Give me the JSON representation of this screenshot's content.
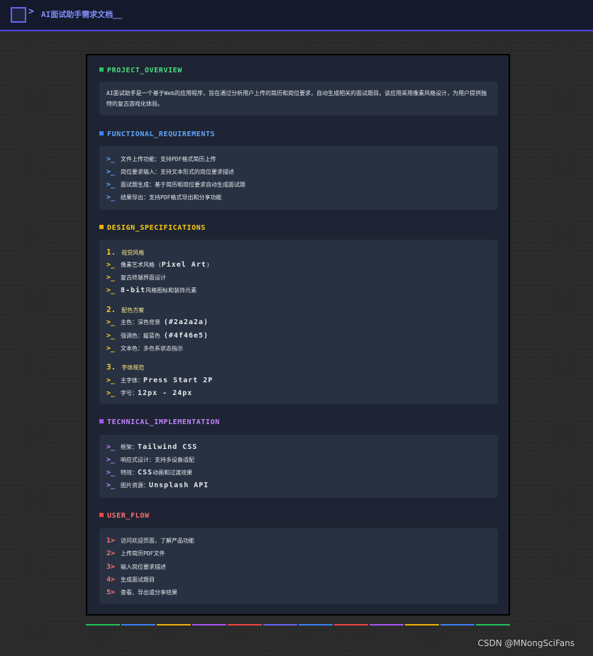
{
  "header": {
    "logo": "pixel-square-icon",
    "chevron": ">",
    "title": "AI面试助手需求文档__"
  },
  "colors": {
    "accent": "#4f46e5",
    "green": "#22c55e",
    "blue": "#60a5fa",
    "yellow": "#facc15",
    "purple": "#c084fc",
    "red": "#f87171"
  },
  "sections": {
    "overview": {
      "title": "PROJECT_OVERVIEW",
      "text": "AI面试助手是一个基于Web的应用程序，旨在通过分析用户上传的简历和岗位要求，自动生成相关的面试题目。该应用采用像素风格设计，为用户提供独特的复古游戏化体验。"
    },
    "functional": {
      "title": "FUNCTIONAL_REQUIREMENTS",
      "marker": ">_",
      "items": [
        "文件上传功能：支持PDF格式简历上传",
        "岗位要求输入：支持文本形式的岗位要求描述",
        "面试题生成：基于简历和岗位要求自动生成面试题",
        "结果导出：支持PDF格式导出和分享功能"
      ]
    },
    "design": {
      "title": "DESIGN_SPECIFICATIONS",
      "marker": ">_",
      "groups": [
        {
          "num": "1.",
          "heading": "视觉风格",
          "items": [
            {
              "zh": "像素艺术风格 (",
              "en": "Pixel Art",
              "tail": ")"
            },
            {
              "zh": "复古终端界面设计",
              "en": "",
              "tail": ""
            },
            {
              "zh": "",
              "en": "8-bit",
              "tail": "风格图标和装饰元素"
            }
          ]
        },
        {
          "num": "2.",
          "heading": "配色方案",
          "items": [
            {
              "zh": "主色：深色背景 ",
              "en": "(#2a2a2a)",
              "tail": ""
            },
            {
              "zh": "强调色：靛蓝色 ",
              "en": "(#4f46e5)",
              "tail": ""
            },
            {
              "zh": "文本色：多色系状态指示",
              "en": "",
              "tail": ""
            }
          ]
        },
        {
          "num": "3.",
          "heading": "字体规范",
          "items": [
            {
              "zh": "主字体：",
              "en": "Press Start 2P",
              "tail": ""
            },
            {
              "zh": "字号：",
              "en": "12px - 24px",
              "tail": ""
            }
          ]
        }
      ]
    },
    "technical": {
      "title": "TECHNICAL_IMPLEMENTATION",
      "marker": ">_",
      "items": [
        {
          "zh": "框架：",
          "en": "Tailwind CSS",
          "tail": ""
        },
        {
          "zh": "响应式设计：支持多设备适配",
          "en": "",
          "tail": ""
        },
        {
          "zh": "特效：",
          "en": "CSS",
          "tail": "动画和过渡效果"
        },
        {
          "zh": "图片资源：",
          "en": "Unsplash API",
          "tail": ""
        }
      ]
    },
    "userflow": {
      "title": "USER_FLOW",
      "items": [
        {
          "num": "1>",
          "text": "访问欢迎页面，了解产品功能"
        },
        {
          "num": "2>",
          "text": "上传简历PDF文件"
        },
        {
          "num": "3>",
          "text": "输入岗位要求描述"
        },
        {
          "num": "4>",
          "text": "生成面试题目"
        },
        {
          "num": "5>",
          "text": "查看、导出或分享结果"
        }
      ]
    }
  },
  "watermark": "CSDN @MNongSciFans"
}
